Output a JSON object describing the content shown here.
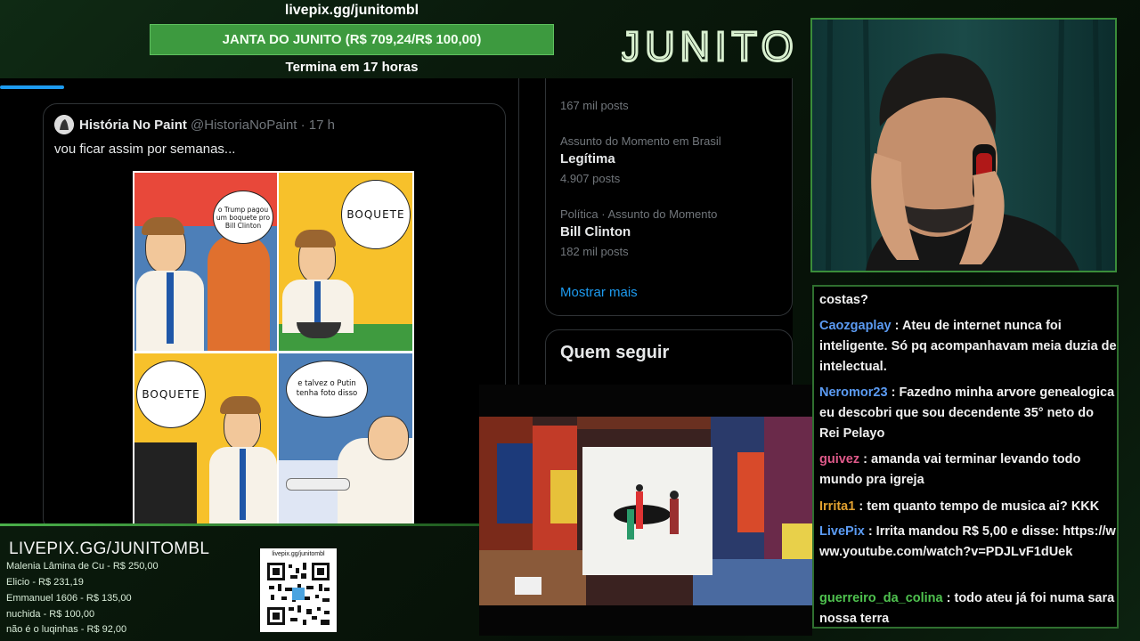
{
  "overlay": {
    "donate_url": "livepix.gg/junitombl",
    "goal_text": "JANTA DO JUNITO (R$ 709,24/R$ 100,00)",
    "goal_ends": "Termina em 17 horas",
    "brand": "JUNITO",
    "accent": "#3d9a3f"
  },
  "tweet": {
    "author_name": "História No Paint",
    "author_handle": "@HistoriaNoPaint · 17 h",
    "text": "vou ficar assim por semanas...",
    "comic": {
      "bubble1": "o Trump pagou um boquete pro Bill Clinton",
      "bubble2": "BOQUETE",
      "bubble3": "BOQUETE",
      "bubble4": "e talvez o Putin tenha foto disso"
    }
  },
  "sidebar": {
    "trend0_count": "167 mil posts",
    "trend1_context": "Assunto do Momento em Brasil",
    "trend1_title": "Legítima",
    "trend1_count": "4.907 posts",
    "trend2_context": "Política · Assunto do Momento",
    "trend2_title": "Bill Clinton",
    "trend2_count": "182 mil posts",
    "show_more": "Mostrar mais",
    "who_to_follow": "Quem seguir"
  },
  "chat": {
    "messages": [
      {
        "user": "",
        "color": "#ffffff",
        "text": "costas?"
      },
      {
        "user": "Caozgaplay",
        "color": "#5b9bf3",
        "text": ": Ateu de internet nunca foi inteligente. Só pq acompanhavam meia duzia de intelectual."
      },
      {
        "user": "Neromor23",
        "color": "#5b9bf3",
        "text": ": Fazedno minha arvore genealogica eu descobri que sou decendente 35° neto do Rei Pelayo"
      },
      {
        "user": "guivez",
        "color": "#e05a8a",
        "text": ": amanda vai terminar levando todo mundo pra igreja"
      },
      {
        "user": "Irrita1",
        "color": "#e0a030",
        "text": ": tem quanto tempo de musica ai? KKK"
      },
      {
        "user": "LivePix",
        "color": "#5b9bf3",
        "text": ": Irrita mandou R$ 5,00 e disse: https://www.youtube.com/watch?v=PDJLvF1dUek"
      },
      {
        "user": "guerreiro_da_colina",
        "color": "#4fc24f",
        "text": ": todo ateu já foi numa sara nossa terra"
      }
    ]
  },
  "donations": {
    "title": "LIVEPIX.GG/JUNITOMBL",
    "list": [
      "Malenia Lâmina de Cu - R$ 250,00",
      "Elicio - R$ 231,19",
      "Emmanuel 1606 - R$ 135,00",
      "nuchida - R$ 100,00",
      "não é o luqinhas - R$ 92,00"
    ],
    "qr_url": "livepix.gg/junitombl"
  }
}
